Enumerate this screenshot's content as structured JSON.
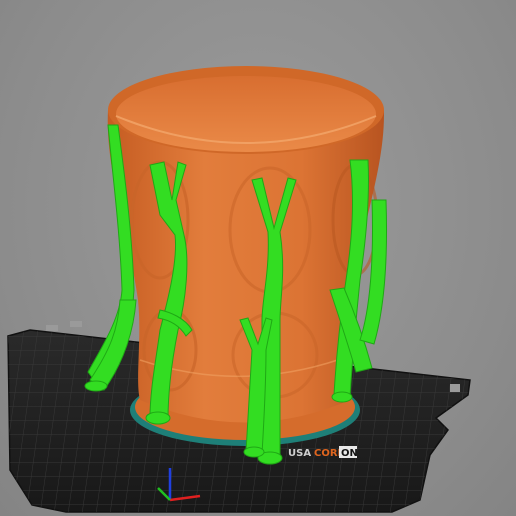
{
  "bed": {
    "brand_prefix": "USA",
    "brand_core": "CORE",
    "brand_suffix": "ON"
  },
  "colors": {
    "background": "#8f8f8f",
    "bed_plate": "#1f1f1f",
    "bed_grid": "#3a3a3a",
    "model_orange": "#e07a3a",
    "support_green": "#33dd22",
    "brim_teal": "#1e7f78",
    "axis_x": "#e02020",
    "axis_y": "#20c020",
    "axis_z": "#2040e0"
  },
  "icons": [
    "axis-gizmo-icon"
  ]
}
